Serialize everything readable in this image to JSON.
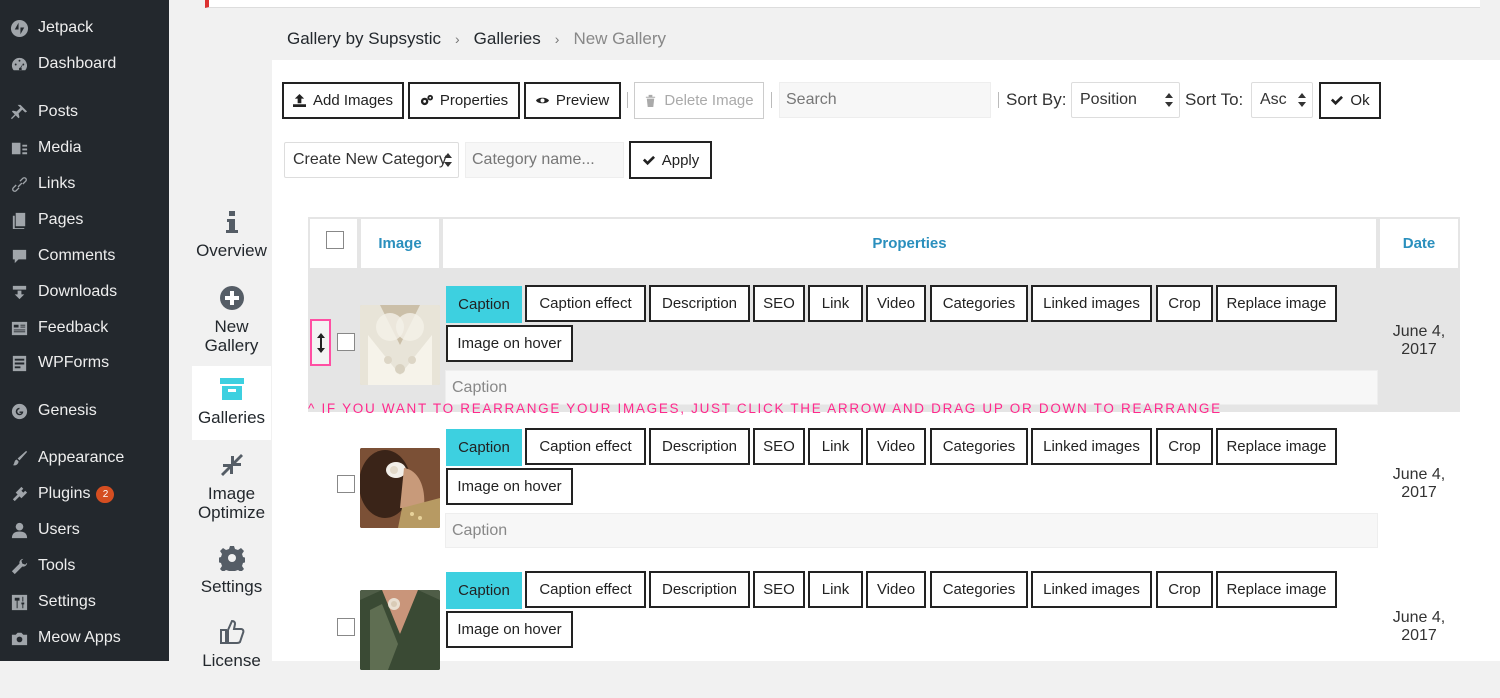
{
  "sidebar": {
    "items": [
      {
        "label": "Jetpack",
        "icon": "jetpack-icon"
      },
      {
        "label": "Dashboard",
        "icon": "dashboard-icon"
      },
      {
        "label": "Posts",
        "icon": "pin-icon"
      },
      {
        "label": "Media",
        "icon": "media-icon"
      },
      {
        "label": "Links",
        "icon": "link-icon"
      },
      {
        "label": "Pages",
        "icon": "pages-icon"
      },
      {
        "label": "Comments",
        "icon": "comment-icon"
      },
      {
        "label": "Downloads",
        "icon": "download-icon"
      },
      {
        "label": "Feedback",
        "icon": "feedback-icon"
      },
      {
        "label": "WPForms",
        "icon": "form-icon"
      },
      {
        "label": "Genesis",
        "icon": "genesis-icon"
      },
      {
        "label": "Appearance",
        "icon": "brush-icon"
      },
      {
        "label": "Plugins",
        "icon": "plugin-icon",
        "badge": "2"
      },
      {
        "label": "Users",
        "icon": "user-icon"
      },
      {
        "label": "Tools",
        "icon": "wrench-icon"
      },
      {
        "label": "Settings",
        "icon": "settings-icon"
      },
      {
        "label": "Meow Apps",
        "icon": "camera-icon"
      }
    ]
  },
  "plugin_nav": {
    "items": [
      {
        "label": "Overview",
        "icon": "info-icon"
      },
      {
        "label": "New Gallery",
        "icon": "plus-circle-icon"
      },
      {
        "label": "Galleries",
        "icon": "archive-icon",
        "active": true
      },
      {
        "label": "Image Optimize",
        "icon": "compress-icon"
      },
      {
        "label": "Settings",
        "icon": "gear-icon"
      },
      {
        "label": "License",
        "icon": "thumbs-up-icon"
      }
    ]
  },
  "breadcrumb": {
    "items": [
      "Gallery by Supsystic",
      "Galleries",
      "New Gallery"
    ],
    "separator": "›"
  },
  "toolbar": {
    "add_images": "Add Images",
    "properties": "Properties",
    "preview": "Preview",
    "delete_image": "Delete Image",
    "search_placeholder": "Search",
    "sort_by_label": "Sort By:",
    "sort_by_value": "Position",
    "sort_to_label": "Sort To:",
    "sort_to_value": "Asc",
    "ok": "Ok"
  },
  "category_bar": {
    "select_value": "Create New Category",
    "name_placeholder": "Category name...",
    "apply": "Apply"
  },
  "table": {
    "headers": {
      "image": "Image",
      "properties": "Properties",
      "date": "Date"
    },
    "tabs": [
      "Caption",
      "Caption effect",
      "Description",
      "SEO",
      "Link",
      "Video",
      "Categories",
      "Linked images",
      "Crop",
      "Replace image",
      "Image on hover"
    ],
    "caption_placeholder": "Caption",
    "rows": [
      {
        "date_line1": "June 4,",
        "date_line2": "2017"
      },
      {
        "date_line1": "June 4,",
        "date_line2": "2017"
      },
      {
        "date_line1": "June 4,",
        "date_line2": "2017"
      }
    ]
  },
  "hint_text": "^ If you want to rearrange your images, just click the arrow and drag up or down to rearrange",
  "colors": {
    "accent": "#3dd0e0",
    "header_link": "#2a8fbd",
    "hint": "#ff2a8d",
    "sidebar_bg": "#23282d"
  }
}
